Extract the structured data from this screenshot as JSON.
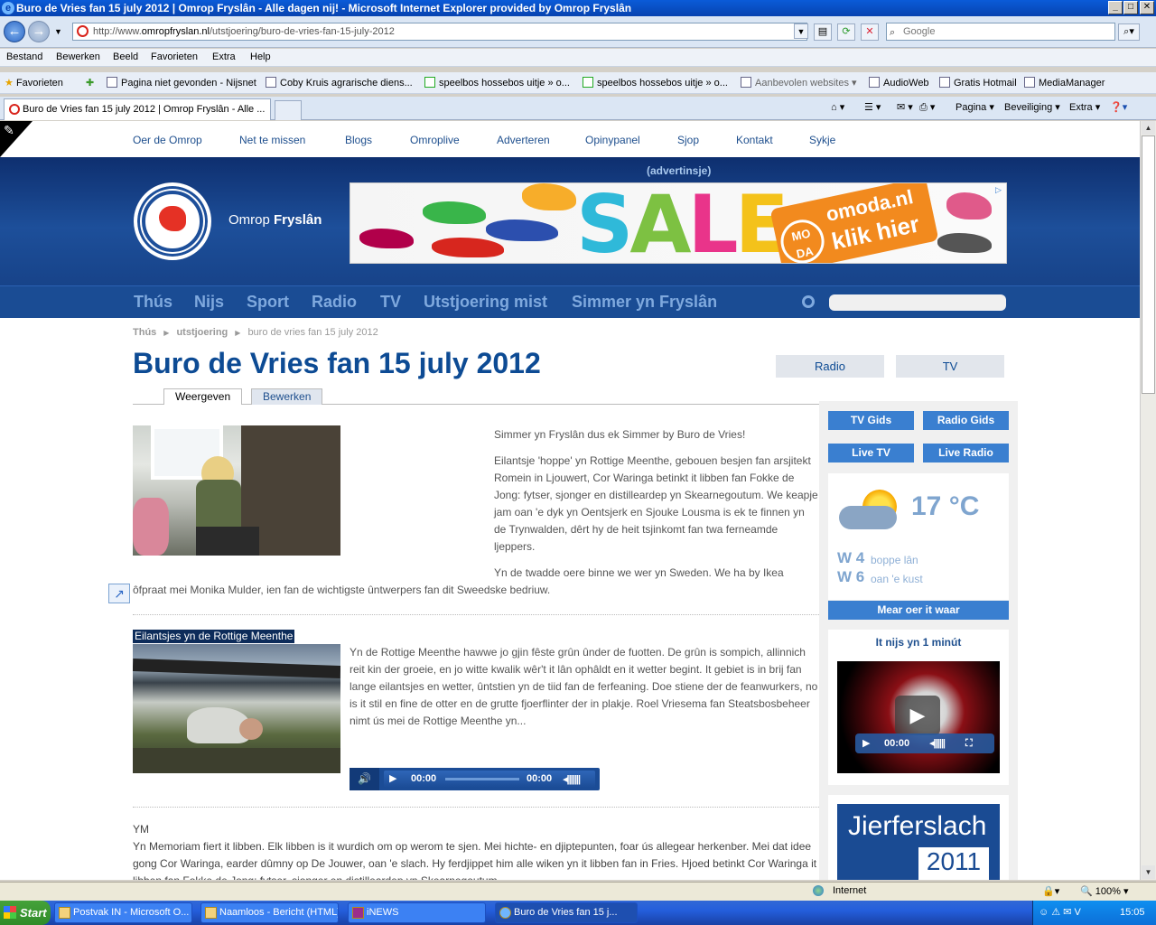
{
  "window": {
    "title": "Buro de Vries fan 15 july 2012 | Omrop Fryslân - Alle dagen nij! - Microsoft Internet Explorer provided by Omrop Fryslân",
    "min": "_",
    "max": "□",
    "close": "✕"
  },
  "address": {
    "prefix": "http://www.",
    "domain": "omropfryslan.nl",
    "path": "/utstjoering/buro-de-vries-fan-15-july-2012",
    "search_placeholder": "Google"
  },
  "menu": [
    "Bestand",
    "Bewerken",
    "Beeld",
    "Favorieten",
    "Extra",
    "Help"
  ],
  "favorites": {
    "label": "Favorieten",
    "items": [
      "Pagina niet gevonden - Nijsnet",
      "Coby Kruis  agrarische diens...",
      "speelbos hossebos uitje » o...",
      "speelbos hossebos uitje » o...",
      "Aanbevolen websites",
      "AudioWeb",
      "Gratis Hotmail",
      "MediaManager"
    ]
  },
  "tabbar": {
    "tab_title": "Buro de Vries fan 15 july 2012 | Omrop Fryslân - Alle ...",
    "cmds": [
      "Pagina",
      "Beveiliging",
      "Extra"
    ]
  },
  "site": {
    "topnav": [
      "Oer de Omrop",
      "Net te missen",
      "Blogs",
      "Omroplive",
      "Adverteren",
      "Opinypanel",
      "Sjop",
      "Kontakt",
      "Sykje"
    ],
    "brand_a": "Omrop ",
    "brand_b": "Fryslân",
    "ad_label": "(advertinsje)",
    "ad": {
      "sale": "SALE",
      "mo": "MO",
      "da": "DA",
      "omoda": "omoda.nl",
      "cta": "klik hier"
    },
    "mainnav": [
      "Thús",
      "Nijs",
      "Sport",
      "Radio",
      "TV",
      "Utstjoering mist",
      "Simmer yn Fryslân"
    ],
    "breadcrumb": [
      "Thús",
      "utstjoering",
      "buro de vries fan 15 july 2012"
    ],
    "title": "Buro de Vries fan 15 july 2012",
    "tabs": [
      "Weergeven",
      "Bewerken"
    ],
    "intro_1": "Simmer yn Fryslân dus ek Simmer by Buro de Vries!",
    "intro_2": "Eilantsje 'hoppe' yn Rottige Meenthe, gebouen besjen fan arsjitekt Romein in Ljouwert, Cor Waringa betinkt it libben fan Fokke de Jong: fytser, sjonger en distilleardeр yn Skearnegoutum. We keapje jam oan 'e dyk yn Oentsjerk en Sjouke Lousma is ek te finnen yn de Trynwalden, dêrt hy de heit tsjinkomt fan twa ferneamde ljeppers.",
    "intro_3": "Yn de twadde oere binne we wer yn Sweden. We ha by Ikea ôfpraat mei Monika Mulder, ien fan de wichtigste ûntwerpers fan dit Sweedske bedriuw.",
    "item2_caption": "Eilantsjes yn de Rottige Meenthe",
    "item2_text": "Yn de Rottige Meenthe hawwe jo gjin fêste grûn ûnder de fuotten. De grûn is sompich, allinnich reit kin der groeie, en jo witte kwalik wêr't it lân ophâldt en it wetter begint. It gebiet is in brij fan lange eilantsjes en wetter, ûntstien yn de tiid fan de ferfeaning. Doe stiene der de feanwurkers, no is it stil en fine de otter en de grutte fjoerflinter der in plakje. Roel Vriesema fan Steatsbosbeheer nimt ús mei de Rottige Meenthe yn...",
    "player": {
      "time_elapsed": "00:00",
      "time_total": "00:00"
    },
    "item3_label": "YM",
    "item3_text": "Yn Memoriam fiert it libben. Elk libben is it wurdich om op werom te sjen. Mei hichte- en djiptepunten, foar ús allegear herkenber. Mei dat idee gong Cor Waringa, earder dûmny op De Jouwer, oan 'e slach. Hy ferdjippet him alle wiken yn it libben fan in Fries. Hjoed betinkt Cor Waringa it libben fan Fokke de Jong: fytser, sjonger en distilleardeр yn Skearnegoutum.",
    "side": {
      "radio": "Radio",
      "tv": "TV",
      "tvgids": "TV Gids",
      "radiogids": "Radio Gids",
      "livetv": "Live TV",
      "liveradio": "Live Radio",
      "temp": "17 °C",
      "w1": "W 4",
      "w1_label": "boppe lân",
      "w2": "W 6",
      "w2_label": "oan 'e kust",
      "more_weather": "Mear oer it waar",
      "nijs_title": "It nijs yn 1 minút",
      "video_time": "00:00",
      "promo_1": "Jierferslach",
      "promo_2": "2011"
    }
  },
  "status": {
    "zone": "Internet",
    "zoom": "100%"
  },
  "taskbar": {
    "start": "Start",
    "tasks": [
      "Postvak IN - Microsoft O...",
      "Naamloos - Bericht (HTML)",
      "iNEWS",
      "Buro de Vries fan 15 j..."
    ],
    "clock": "15:05"
  }
}
